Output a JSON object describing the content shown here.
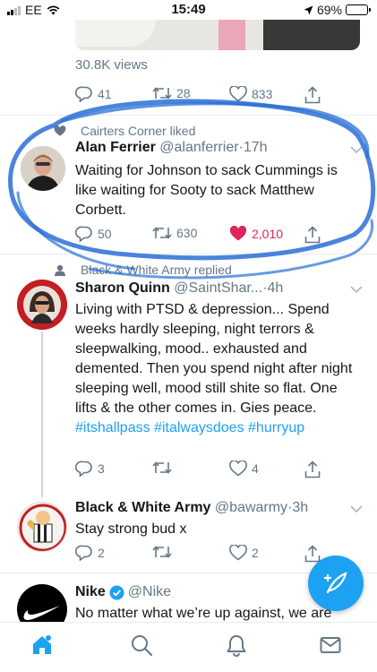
{
  "status_bar": {
    "carrier": "EE",
    "time": "15:49",
    "battery_percent": "69%",
    "battery_level": 0.69
  },
  "prev_tweet": {
    "views": "30.8K views",
    "replies": "41",
    "retweets": "28",
    "likes": "833"
  },
  "tweets": [
    {
      "context": "Cairters Corner liked",
      "name": "Alan Ferrier",
      "handle": "@alanferrier",
      "sep": "·",
      "time": "17h",
      "text": "Waiting for Johnson to sack Cummings is like waiting for Sooty to sack Matthew Corbett.",
      "replies": "50",
      "retweets": "630",
      "likes": "2,010",
      "liked": true
    },
    {
      "context": "Black & White Army replied",
      "name": "Sharon Quinn",
      "handle": "@SaintShar...",
      "sep": "·",
      "time": "4h",
      "text": "Living with PTSD & depression... Spend weeks hardly sleeping, night terrors & sleepwalking, mood.. exhausted and demented. Then you spend night after night sleeping well, mood still shite so flat. One lifts & the other comes in. Gies peace.",
      "hashtags": [
        "#itshallpass",
        "#italwaysdoes",
        "#hurryup"
      ],
      "replies": "3",
      "retweets": "",
      "likes": "4"
    },
    {
      "name": "Black & White Army",
      "handle": "@bawarmy",
      "sep": "·",
      "time": "3h",
      "text": "Stay strong bud x",
      "replies": "2",
      "retweets": "",
      "likes": "2"
    },
    {
      "name": "Nike",
      "handle": "@Nike",
      "text": "No matter what we’re up against, we are"
    }
  ],
  "colors": {
    "accent": "#1da1f2",
    "like": "#e0245e",
    "secondary_text": "#657786",
    "scribble": "#2a6fd6"
  },
  "icons": [
    "reply-icon",
    "retweet-icon",
    "like-icon",
    "share-icon",
    "chevron-down-icon",
    "verified-icon",
    "compose-icon",
    "home-icon",
    "search-icon",
    "notifications-icon",
    "messages-icon"
  ]
}
